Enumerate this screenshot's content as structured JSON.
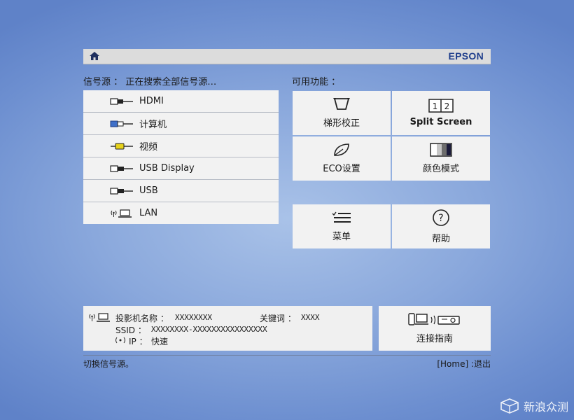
{
  "header": {
    "brand": "EPSON",
    "home_icon": "home-icon"
  },
  "sources": {
    "label": "信号源 ： 正在搜索全部信号源…",
    "items": [
      {
        "label": "HDMI",
        "icon": "hdmi-cable-icon"
      },
      {
        "label": "计算机",
        "icon": "vga-cable-icon"
      },
      {
        "label": "视频",
        "icon": "rca-cable-icon"
      },
      {
        "label": "USB Display",
        "icon": "usb-display-icon"
      },
      {
        "label": "USB",
        "icon": "usb-icon"
      },
      {
        "label": "LAN",
        "icon": "lan-icon"
      }
    ]
  },
  "functions": {
    "label": "可用功能 ：",
    "items": [
      {
        "label": "梯形校正",
        "icon": "keystone-icon"
      },
      {
        "label": "Split Screen",
        "icon": "split-screen-icon"
      },
      {
        "label": "ECO设置",
        "icon": "leaf-icon"
      },
      {
        "label": "颜色模式",
        "icon": "color-mode-icon"
      },
      {
        "label": "菜单",
        "icon": "menu-icon"
      },
      {
        "label": "帮助",
        "icon": "help-icon"
      }
    ]
  },
  "network": {
    "projector_name_label": "投影机名称 ：",
    "projector_name_value": "XXXXXXXX",
    "keyword_label": "关键词 ：",
    "keyword_value": "XXXX",
    "ssid_label": "SSID ：",
    "ssid_value": "XXXXXXXX-XXXXXXXXXXXXXXXX",
    "ip_label": "IP ：",
    "ip_value": "快速"
  },
  "guide": {
    "label": "连接指南",
    "icon": "connection-guide-icon"
  },
  "footer": {
    "left": "切换信号源。",
    "right": "[Home] :退出"
  },
  "watermark": {
    "text": "新浪众测"
  }
}
